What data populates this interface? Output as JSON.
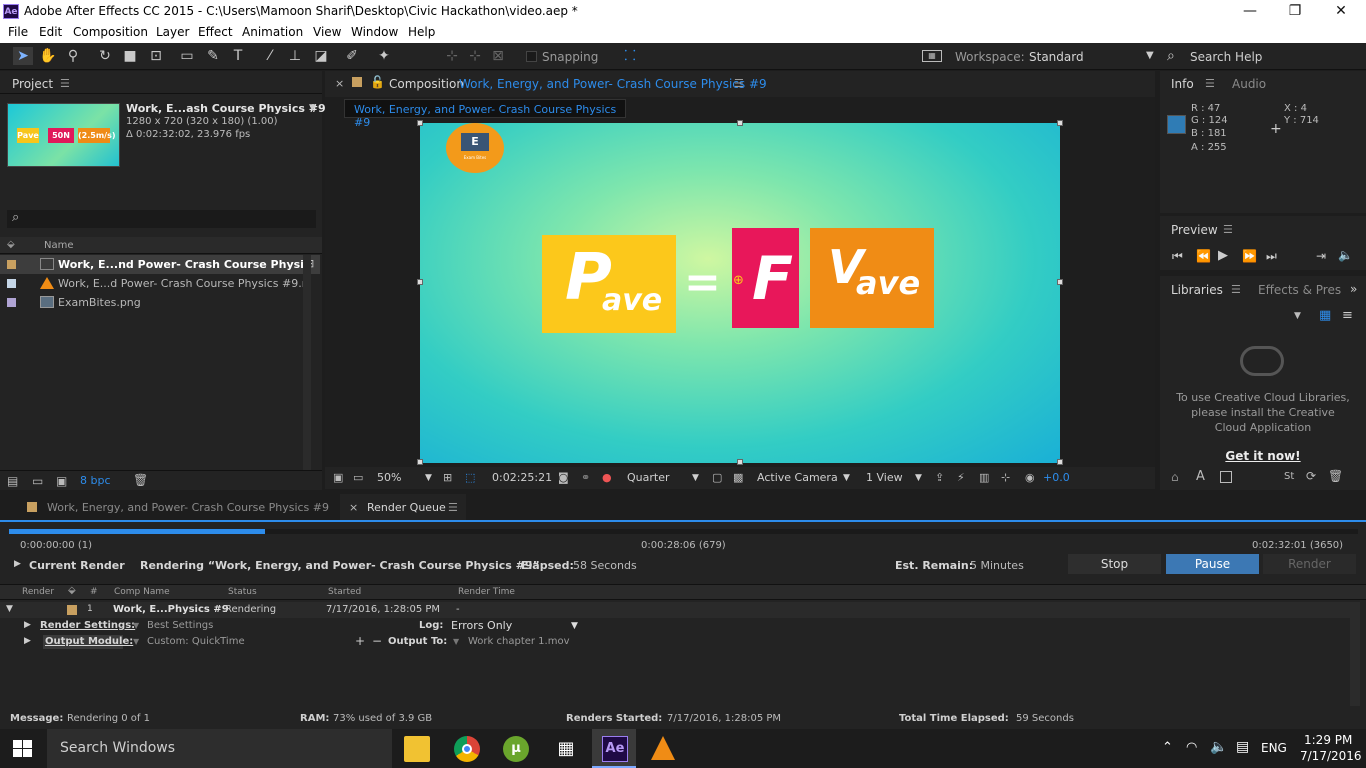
{
  "window": {
    "app_icon": "Ae",
    "title": "Adobe After Effects CC 2015 - C:\\Users\\Mamoon Sharif\\Desktop\\Civic Hackathon\\video.aep *",
    "min_glyph": "—",
    "max_glyph": "❐",
    "close_glyph": "✕"
  },
  "menu": [
    "File",
    "Edit",
    "Composition",
    "Layer",
    "Effect",
    "Animation",
    "View",
    "Window",
    "Help"
  ],
  "toolbar": {
    "snapping_label": "Snapping",
    "workspace_label": "Workspace:",
    "workspace_value": "Standard",
    "search_placeholder": "Search Help"
  },
  "project": {
    "tab_label": "Project",
    "comp_name": "Work, E...ash Course Physics #9",
    "comp_info_1": "1280 x 720  (320 x 180) (1.00)",
    "comp_info_2": "Δ 0:02:32:02, 23.976 fps",
    "thumb": {
      "b1": "Pave",
      "b2": "50N",
      "b3": "(2.5m/s)"
    },
    "search_icon": "⌕",
    "column_name": "Name",
    "items": [
      {
        "name": "Work, E...nd Power- Crash Course Physics #",
        "type": "composition",
        "color": "#c8a060",
        "selected": true
      },
      {
        "name": "Work, E...d Power- Crash Course Physics #9.mp4",
        "type": "video",
        "color": "#c5d6e6",
        "selected": false
      },
      {
        "name": "ExamBites.png",
        "type": "image",
        "color": "#b0a4d4",
        "selected": false
      }
    ],
    "bpc_label": "8 bpc"
  },
  "composition": {
    "tab_prefix": "Composition",
    "tab_name": "Work, Energy, and Power- Crash Course Physics #9",
    "breadcrumb": "Work, Energy, and Power- Crash Course Physics #9",
    "logo_letter": "E",
    "logo_caption": "Exam Bites",
    "formula": {
      "p": "P",
      "p_sub": "ave",
      "eq": "=",
      "f": "F",
      "v": "V",
      "v_sub": "ave"
    },
    "colors": {
      "yellow": "#fcc81b",
      "pink": "#e8175a",
      "orange": "#f08c15"
    }
  },
  "viewer": {
    "zoom": "50%",
    "timecode": "0:02:25:21",
    "resolution": "Quarter",
    "camera": "Active Camera",
    "views": "1 View",
    "exposure": "+0.0"
  },
  "info": {
    "tab_label": "Info",
    "tab_audio": "Audio",
    "r": "R : 47",
    "g": "G : 124",
    "b": "B : 181",
    "a": "A : 255",
    "x": "X : 4",
    "y": "Y : 714",
    "swatch": "#2f7cb5"
  },
  "preview": {
    "tab_label": "Preview"
  },
  "libraries": {
    "tab_label": "Libraries",
    "tab_effects": "Effects & Pres",
    "message": "To use Creative Cloud Libraries, please install the Creative Cloud Application",
    "link": "Get it now!"
  },
  "bottom_tabs": {
    "timeline": "Work, Energy, and Power- Crash Course Physics #9",
    "render_queue": "Render Queue"
  },
  "render_queue": {
    "progress": 0.19,
    "time_start": "0:00:00:00 (1)",
    "time_mid": "0:00:28:06 (679)",
    "time_end": "0:02:32:01 (3650)",
    "current_render_label": "Current Render",
    "rendering_text": "Rendering “Work, Energy, and Power- Crash Course Physics #9”",
    "elapsed_label": "Elapsed:",
    "elapsed_value": "58 Seconds",
    "remain_label": "Est. Remain:",
    "remain_value": "5 Minutes",
    "stop_label": "Stop",
    "pause_label": "Pause",
    "render_label": "Render",
    "columns": {
      "render": "Render",
      "num": "#",
      "comp": "Comp Name",
      "status": "Status",
      "started": "Started",
      "render_time": "Render Time"
    },
    "row": {
      "num": "1",
      "comp": "Work, E...Physics #9",
      "status": "Rendering",
      "started": "7/17/2016, 1:28:05 PM",
      "render_time": "-"
    },
    "render_settings_label": "Render Settings:",
    "render_settings_value": "Best Settings",
    "log_label": "Log:",
    "log_value": "Errors Only",
    "output_module_label": "Output Module:",
    "output_module_value": "Custom: QuickTime",
    "output_to_label": "Output To:",
    "output_to_value": "Work chapter 1.mov"
  },
  "status_bar": {
    "message_label": "Message:",
    "message_value": "Rendering 0 of 1",
    "ram_label": "RAM:",
    "ram_value": "73% used of 3.9 GB",
    "renders_started_label": "Renders Started:",
    "renders_started_value": "7/17/2016, 1:28:05 PM",
    "total_elapsed_label": "Total Time Elapsed:",
    "total_elapsed_value": "59 Seconds"
  },
  "taskbar": {
    "search_placeholder": "Search Windows",
    "language": "ENG",
    "time": "1:29 PM",
    "date": "7/17/2016",
    "apps": [
      "file-explorer",
      "chrome",
      "utorrent",
      "calculator",
      "after-effects",
      "vlc"
    ]
  }
}
